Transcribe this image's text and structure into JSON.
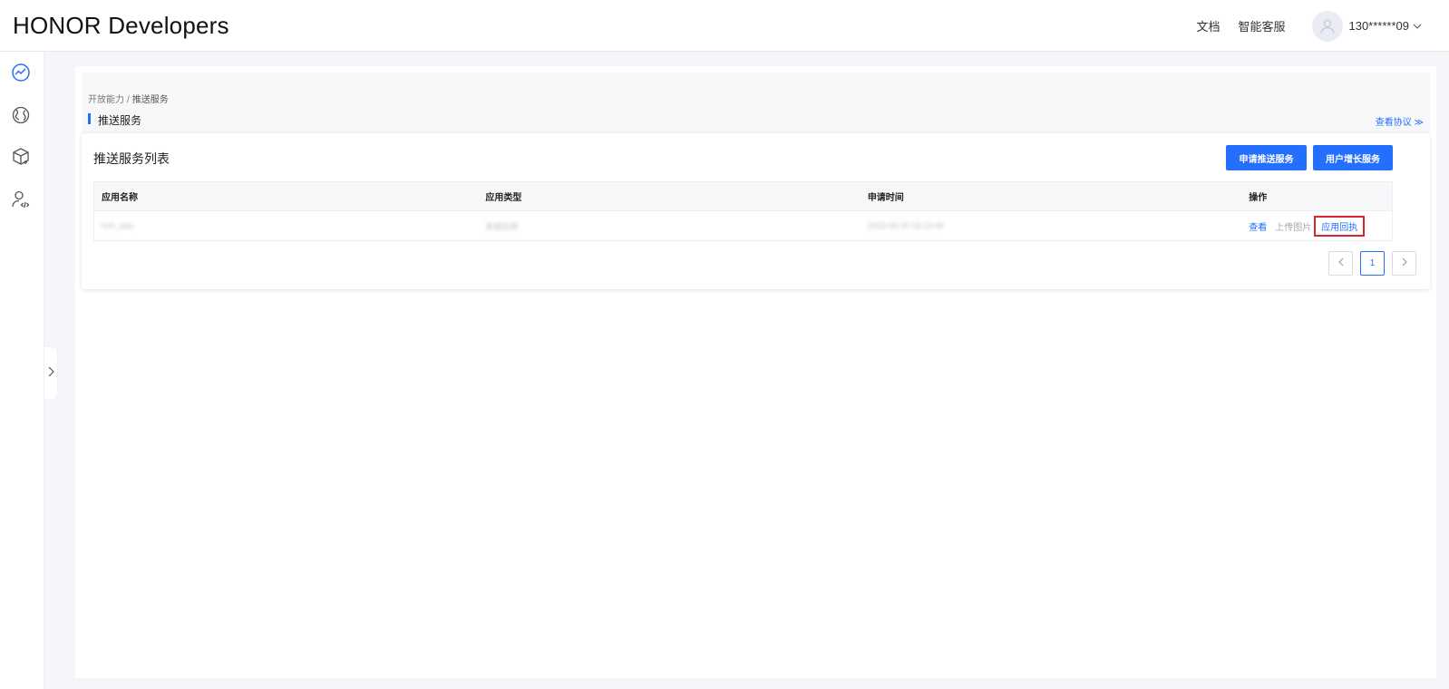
{
  "header": {
    "logo": "HONOR Developers",
    "nav_docs": "文档",
    "nav_support": "智能客服",
    "username": "130******09"
  },
  "breadcrumb": {
    "parent": "开放能力",
    "separator": "/",
    "current": "推送服务"
  },
  "page": {
    "title": "推送服务",
    "agreement_link": "查看协议 ≫"
  },
  "card": {
    "title": "推送服务列表",
    "apply_button": "申请推送服务",
    "growth_button": "用户增长服务"
  },
  "table": {
    "columns": [
      "应用名称",
      "应用类型",
      "申请时间",
      "操作"
    ],
    "rows": [
      {
        "app_name": "hnh_dao",
        "app_type": "系统应用",
        "applied_at": "2023-06-20 16:23:48",
        "actions": {
          "view": "查看",
          "upload": "上传图片",
          "receipt": "应用回执"
        }
      }
    ]
  },
  "pagination": {
    "current_page": "1"
  },
  "colors": {
    "accent": "#256fff",
    "highlight_border": "#d9252f"
  },
  "icons": {
    "rail": [
      "dashboard-icon",
      "globe-icon",
      "package-icon",
      "developer-user-icon"
    ],
    "header": [
      "avatar-icon",
      "chevron-down-icon"
    ]
  }
}
